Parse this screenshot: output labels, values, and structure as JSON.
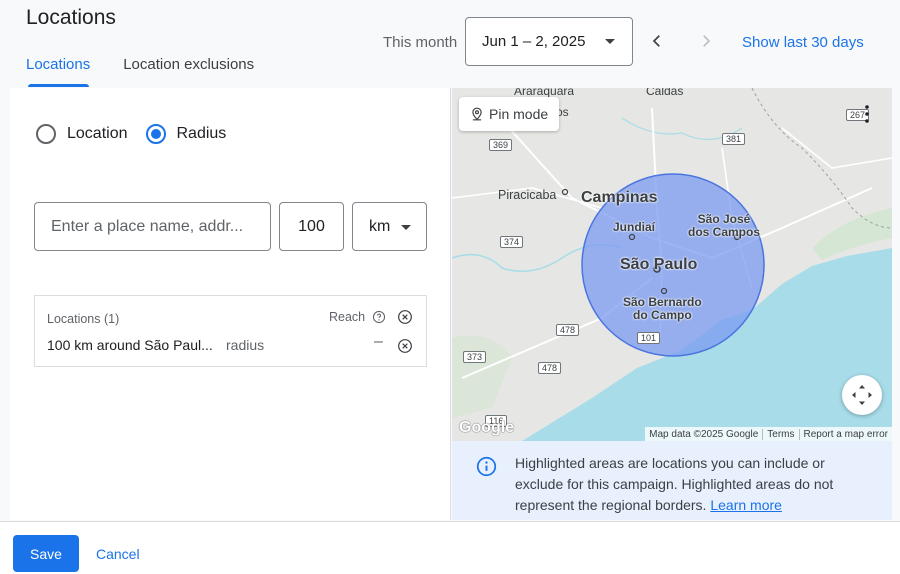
{
  "page": {
    "title": "Locations"
  },
  "tabs": [
    {
      "label": "Locations",
      "active": true
    },
    {
      "label": "Location exclusions",
      "active": false
    }
  ],
  "date_range": {
    "label": "This month",
    "selected": "Jun 1 – 2, 2025",
    "show_last": "Show last 30 days"
  },
  "targeting": {
    "options": [
      {
        "label": "Location",
        "selected": false
      },
      {
        "label": "Radius",
        "selected": true
      }
    ],
    "place_placeholder": "Enter a place name, addr...",
    "radius_value": "100",
    "unit": "km"
  },
  "locations_box": {
    "header": "Locations (1)",
    "reach_label": "Reach",
    "row": {
      "name": "100 km around São Paul...",
      "type": "radius",
      "reach": "–"
    }
  },
  "map": {
    "pin_mode_label": "Pin mode",
    "labels": {
      "araraquara": "Araraquara",
      "caldas": "Caldas",
      "os": "os",
      "piracicaba": "Piracicaba",
      "campinas": "Campinas",
      "jundiai": "Jundiaí",
      "sao_jose": "São José\ndos Campos",
      "sao_paulo": "São Paulo",
      "sao_bernardo": "São Bernardo\ndo Campo"
    },
    "roads": [
      "369",
      "381",
      "374",
      "478",
      "478",
      "373",
      "101",
      "116",
      "267"
    ],
    "attribution": {
      "data": "Map data ©2025 Google",
      "terms": "Terms",
      "report": "Report a map error"
    },
    "logo": "Google",
    "colors": {
      "radius_fill": "#7b9bf0",
      "water": "#a7dce8",
      "land": "#e6e7e4"
    }
  },
  "info": {
    "text": "Highlighted areas are locations you can include or exclude for this campaign. Highlighted areas do not represent the regional borders.",
    "link": "Learn more"
  },
  "footer": {
    "save_label": "Save",
    "cancel_label": "Cancel"
  }
}
